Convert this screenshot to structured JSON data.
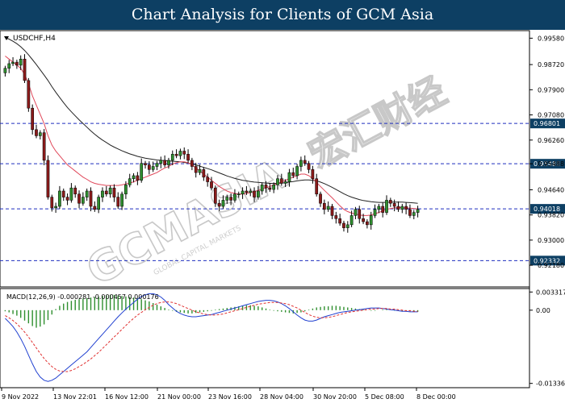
{
  "header": {
    "title": "Chart Analysis for Clients of GCM Asia"
  },
  "watermark": {
    "text": "GCMASIA",
    "cn": "宏汇财经",
    "sub": "GLOBAL CAPITAL MARKETS"
  },
  "colors": {
    "header_bg": "#0d3f63",
    "level_line": "#1f2fbf",
    "ma_fast": "#e0485a",
    "ma_slow": "#222222",
    "macd_hist": "#2f8f2f",
    "macd_line": "#2040d0",
    "macd_signal": "#e03030",
    "bull": "#2f8f2f",
    "bear": "#8b1a1a"
  },
  "chart_data": [
    {
      "type": "candlestick",
      "symbol_label": "USDCHF,H4",
      "ylim": [
        0.915,
        0.998
      ],
      "y_ticks": [
        0.9958,
        0.9872,
        0.979,
        0.9708,
        0.9626,
        0.95488,
        0.9464,
        0.9382,
        0.93,
        0.9218
      ],
      "x_ticks": [
        "9 Nov 2022",
        "13 Nov 22:01",
        "16 Nov 12:00",
        "21 Nov 00:00",
        "23 Nov 16:00",
        "28 Nov 04:00",
        "30 Nov 20:00",
        "5 Dec 08:00",
        "8 Dec 00:00"
      ],
      "levels": [
        0.96801,
        0.95488,
        0.94018,
        0.92332
      ],
      "level_labels": [
        "0.96801",
        "0.95488",
        "0.94018",
        "0.92332"
      ],
      "series_close": [
        0.986,
        0.9875,
        0.988,
        0.987,
        0.989,
        0.982,
        0.973,
        0.966,
        0.964,
        0.965,
        0.956,
        0.944,
        0.9405,
        0.941,
        0.946,
        0.944,
        0.943,
        0.947,
        0.945,
        0.942,
        0.944,
        0.946,
        0.941,
        0.94,
        0.944,
        0.946,
        0.945,
        0.947,
        0.944,
        0.941,
        0.945,
        0.948,
        0.95,
        0.951,
        0.9495,
        0.955,
        0.9545,
        0.953,
        0.954,
        0.955,
        0.956,
        0.9545,
        0.956,
        0.958,
        0.9575,
        0.959,
        0.958,
        0.956,
        0.954,
        0.952,
        0.953,
        0.9505,
        0.949,
        0.947,
        0.942,
        0.941,
        0.943,
        0.944,
        0.943,
        0.945,
        0.945,
        0.946,
        0.9455,
        0.946,
        0.944,
        0.946,
        0.948,
        0.947,
        0.9465,
        0.948,
        0.95,
        0.9485,
        0.949,
        0.952,
        0.951,
        0.954,
        0.956,
        0.955,
        0.953,
        0.95,
        0.945,
        0.942,
        0.94,
        0.941,
        0.938,
        0.937,
        0.9355,
        0.934,
        0.935,
        0.938,
        0.94,
        0.937,
        0.936,
        0.935,
        0.938,
        0.94,
        0.941,
        0.939,
        0.943,
        0.942,
        0.941,
        0.94,
        0.941,
        0.94,
        0.938,
        0.939,
        0.94
      ],
      "ma_fast": [
        0.99,
        0.989,
        0.988,
        0.987,
        0.986,
        0.984,
        0.981,
        0.977,
        0.974,
        0.971,
        0.968,
        0.964,
        0.961,
        0.959,
        0.9575,
        0.956,
        0.9545,
        0.9535,
        0.9525,
        0.9515,
        0.9505,
        0.9498,
        0.949,
        0.9485,
        0.9482,
        0.948,
        0.9478,
        0.9478,
        0.9478,
        0.9478,
        0.948,
        0.9483,
        0.9486,
        0.949,
        0.9495,
        0.95,
        0.9505,
        0.951,
        0.9515,
        0.952,
        0.9528,
        0.9535,
        0.954,
        0.9548,
        0.9552,
        0.9555,
        0.9555,
        0.9552,
        0.9545,
        0.9535,
        0.9525,
        0.9515,
        0.9505,
        0.9495,
        0.9485,
        0.9475,
        0.9467,
        0.946,
        0.9455,
        0.9452,
        0.945,
        0.945,
        0.9452,
        0.9455,
        0.9458,
        0.9462,
        0.9466,
        0.947,
        0.9475,
        0.948,
        0.9485,
        0.949,
        0.9495,
        0.95,
        0.9505,
        0.951,
        0.9515,
        0.9515,
        0.951,
        0.95,
        0.9488,
        0.9475,
        0.9462,
        0.945,
        0.9438,
        0.9425,
        0.9412,
        0.94,
        0.9393,
        0.9388,
        0.9385,
        0.9382,
        0.938,
        0.938,
        0.9382,
        0.9386,
        0.939,
        0.9395,
        0.94,
        0.9403,
        0.9405,
        0.9406,
        0.9406,
        0.9405,
        0.9404,
        0.9403,
        0.9402
      ],
      "ma_slow": [
        0.996,
        0.9955,
        0.9948,
        0.994,
        0.993,
        0.9918,
        0.9904,
        0.9888,
        0.9872,
        0.9855,
        0.9838,
        0.982,
        0.98,
        0.9782,
        0.9765,
        0.9748,
        0.9732,
        0.9718,
        0.9705,
        0.9692,
        0.968,
        0.9668,
        0.9656,
        0.9645,
        0.9635,
        0.9626,
        0.9618,
        0.961,
        0.9603,
        0.9597,
        0.9591,
        0.9586,
        0.9581,
        0.9577,
        0.9573,
        0.957,
        0.9567,
        0.9565,
        0.9563,
        0.9561,
        0.956,
        0.9559,
        0.9558,
        0.9557,
        0.9556,
        0.9555,
        0.9553,
        0.9551,
        0.9548,
        0.9545,
        0.9541,
        0.9537,
        0.9533,
        0.9529,
        0.9524,
        0.9519,
        0.9514,
        0.9509,
        0.9505,
        0.9501,
        0.9498,
        0.9495,
        0.9493,
        0.9491,
        0.9489,
        0.9488,
        0.9487,
        0.9486,
        0.9485,
        0.9485,
        0.9485,
        0.9486,
        0.9487,
        0.9489,
        0.9491,
        0.9493,
        0.9495,
        0.9496,
        0.9496,
        0.9495,
        0.9493,
        0.9489,
        0.9484,
        0.9478,
        0.9472,
        0.9465,
        0.9458,
        0.9451,
        0.9445,
        0.944,
        0.9436,
        0.9432,
        0.9429,
        0.9427,
        0.9425,
        0.9424,
        0.9423,
        0.9423,
        0.9423,
        0.9424,
        0.9424,
        0.9424,
        0.9424,
        0.9423,
        0.9422,
        0.9421,
        0.942
      ]
    },
    {
      "type": "macd",
      "label": "MACD(12,26,9) -0.000281 -0.000457 0.000176",
      "ylim": [
        -0.014,
        0.0038
      ],
      "y_ticks": [
        0.003317,
        0.0,
        -0.013365
      ],
      "y_tick_labels": [
        "0.003317",
        "0.00",
        "-0.013365"
      ],
      "histogram": [
        -0.0002,
        -0.0004,
        -0.0007,
        -0.001,
        -0.0014,
        -0.0019,
        -0.0024,
        -0.0029,
        -0.0032,
        -0.003,
        -0.0026,
        -0.0018,
        -0.0008,
        0.0002,
        0.0008,
        0.0012,
        0.0015,
        0.0017,
        0.0019,
        0.002,
        0.0021,
        0.0022,
        0.0023,
        0.0024,
        0.0025,
        0.0026,
        0.0027,
        0.0028,
        0.0028,
        0.0027,
        0.0026,
        0.0025,
        0.0024,
        0.0023,
        0.0022,
        0.002,
        0.0018,
        0.0016,
        0.0013,
        0.001,
        0.0007,
        0.0004,
        0.0001,
        -0.0001,
        -0.0003,
        -0.0004,
        -0.0005,
        -0.0006,
        -0.0006,
        -0.0005,
        -0.0004,
        -0.0003,
        -0.0002,
        -0.0001,
        0.0001,
        0.0002,
        0.0003,
        0.0004,
        0.0005,
        0.0006,
        0.0007,
        0.0008,
        0.0009,
        0.0009,
        0.0008,
        0.0007,
        0.0005,
        0.0003,
        0.0001,
        -0.0001,
        -0.0002,
        -0.0003,
        -0.0004,
        -0.0005,
        -0.0006,
        -0.0005,
        -0.0004,
        -0.0002,
        0.0001,
        0.0003,
        0.0005,
        0.0006,
        0.0007,
        0.0007,
        0.0008,
        0.0008,
        0.0007,
        0.0006,
        0.0005,
        0.0004,
        0.0003,
        0.0002,
        0.0001,
        0.0,
        -0.0001,
        -0.0001,
        0.0,
        0.0001,
        0.0001,
        0.0,
        -0.0001,
        -0.0001,
        -0.0002,
        -0.0002,
        -0.0002,
        -0.0003,
        -0.0003
      ],
      "macd": [
        -0.0015,
        -0.0022,
        -0.003,
        -0.004,
        -0.0052,
        -0.0066,
        -0.0082,
        -0.0098,
        -0.0112,
        -0.0122,
        -0.0128,
        -0.013,
        -0.0128,
        -0.0124,
        -0.0118,
        -0.0112,
        -0.0106,
        -0.01,
        -0.0094,
        -0.0088,
        -0.0082,
        -0.0076,
        -0.0068,
        -0.006,
        -0.0052,
        -0.0044,
        -0.0036,
        -0.0028,
        -0.002,
        -0.0012,
        -0.0005,
        0.0002,
        0.0008,
        0.0014,
        0.002,
        0.0025,
        0.0028,
        0.003,
        0.003,
        0.0028,
        0.0024,
        0.0018,
        0.001,
        0.0004,
        -0.0002,
        -0.0006,
        -0.0009,
        -0.0011,
        -0.0012,
        -0.0012,
        -0.0011,
        -0.001,
        -0.0009,
        -0.0008,
        -0.0006,
        -0.0004,
        -0.0002,
        0.0,
        0.0002,
        0.0004,
        0.0006,
        0.0008,
        0.001,
        0.0012,
        0.0014,
        0.0016,
        0.0017,
        0.0018,
        0.0018,
        0.0017,
        0.0015,
        0.0012,
        0.0008,
        0.0003,
        -0.0003,
        -0.0009,
        -0.0014,
        -0.0018,
        -0.002,
        -0.002,
        -0.0018,
        -0.0015,
        -0.0012,
        -0.001,
        -0.0008,
        -0.0006,
        -0.0004,
        -0.0003,
        -0.0002,
        -0.0001,
        0.0,
        0.0001,
        0.0002,
        0.0003,
        0.0004,
        0.0004,
        0.0004,
        0.0003,
        0.0002,
        0.0001,
        0.0,
        -0.0001,
        -0.0002,
        -0.0002,
        -0.0003,
        -0.0003,
        -0.0003
      ],
      "signal": [
        -0.001,
        -0.0014,
        -0.0019,
        -0.0025,
        -0.0032,
        -0.004,
        -0.0049,
        -0.0059,
        -0.0069,
        -0.0079,
        -0.0088,
        -0.0096,
        -0.0103,
        -0.0108,
        -0.0111,
        -0.0112,
        -0.0112,
        -0.011,
        -0.0107,
        -0.0103,
        -0.0099,
        -0.0094,
        -0.0089,
        -0.0083,
        -0.0077,
        -0.007,
        -0.0063,
        -0.0056,
        -0.0049,
        -0.0042,
        -0.0035,
        -0.0028,
        -0.0021,
        -0.0015,
        -0.0009,
        -0.0004,
        0.0001,
        0.0005,
        0.0009,
        0.0012,
        0.0014,
        0.0015,
        0.0015,
        0.0014,
        0.0012,
        0.0009,
        0.0006,
        0.0003,
        0.0,
        -0.0003,
        -0.0005,
        -0.0007,
        -0.0008,
        -0.0009,
        -0.0009,
        -0.0008,
        -0.0007,
        -0.0005,
        -0.0003,
        -0.0001,
        0.0001,
        0.0003,
        0.0005,
        0.0007,
        0.0009,
        0.0011,
        0.0012,
        0.0013,
        0.0014,
        0.0014,
        0.0014,
        0.0013,
        0.0012,
        0.001,
        0.0007,
        0.0004,
        0.0,
        -0.0004,
        -0.0008,
        -0.0011,
        -0.0013,
        -0.0014,
        -0.0014,
        -0.0013,
        -0.0012,
        -0.001,
        -0.0008,
        -0.0006,
        -0.0004,
        -0.0003,
        -0.0002,
        -0.0001,
        0.0,
        0.0001,
        0.0002,
        0.0002,
        0.0003,
        0.0003,
        0.0003,
        0.0002,
        0.0002,
        0.0001,
        0.0,
        -0.0001,
        -0.0001,
        -0.0002,
        -0.0002
      ]
    }
  ]
}
